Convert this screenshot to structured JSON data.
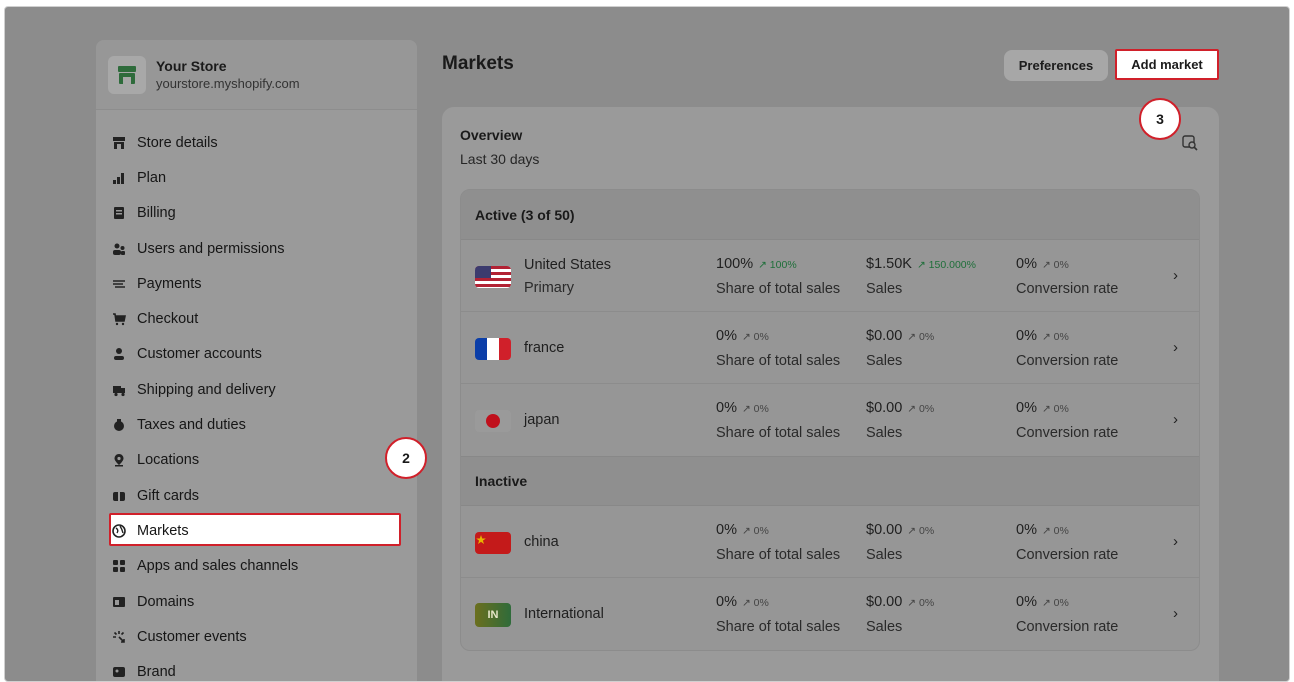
{
  "store": {
    "name": "Your Store",
    "domain": "yourstore.myshopify.com"
  },
  "sidebar": {
    "items": [
      {
        "label": "Store details",
        "icon": "store-icon"
      },
      {
        "label": "Plan",
        "icon": "plan-icon"
      },
      {
        "label": "Billing",
        "icon": "billing-icon"
      },
      {
        "label": "Users and permissions",
        "icon": "users-icon"
      },
      {
        "label": "Payments",
        "icon": "payments-icon"
      },
      {
        "label": "Checkout",
        "icon": "cart-icon"
      },
      {
        "label": "Customer accounts",
        "icon": "person-icon"
      },
      {
        "label": "Shipping and delivery",
        "icon": "truck-icon"
      },
      {
        "label": "Taxes and duties",
        "icon": "taxes-icon"
      },
      {
        "label": "Locations",
        "icon": "location-pin-icon"
      },
      {
        "label": "Gift cards",
        "icon": "gift-card-icon"
      },
      {
        "label": "Markets",
        "icon": "globe-icon"
      },
      {
        "label": "Apps and sales channels",
        "icon": "apps-icon"
      },
      {
        "label": "Domains",
        "icon": "domains-icon"
      },
      {
        "label": "Customer events",
        "icon": "events-icon"
      },
      {
        "label": "Brand",
        "icon": "brand-icon"
      }
    ]
  },
  "header": {
    "title": "Markets",
    "preferences_label": "Preferences",
    "add_market_label": "Add market"
  },
  "overview": {
    "title": "Overview",
    "period": "Last 30 days",
    "active_heading": "Active (3 of 50)",
    "inactive_heading": "Inactive",
    "metric_labels": {
      "share": "Share of total sales",
      "sales": "Sales",
      "conversion": "Conversion rate"
    },
    "markets": [
      {
        "name": "United States",
        "sub": "Primary",
        "flag": "us-flag-icon",
        "share": "100%",
        "share_trend": "↗ 100%",
        "sales": "$1.50K",
        "sales_trend": "↗ 150.000%",
        "conversion": "0%",
        "conversion_trend": "↗ 0%"
      },
      {
        "name": "france",
        "flag": "france-flag-icon",
        "share": "0%",
        "share_trend": "↗ 0%",
        "sales": "$0.00",
        "sales_trend": "↗ 0%",
        "conversion": "0%",
        "conversion_trend": "↗ 0%"
      },
      {
        "name": "japan",
        "flag": "japan-flag-icon",
        "share": "0%",
        "share_trend": "↗ 0%",
        "sales": "$0.00",
        "sales_trend": "↗ 0%",
        "conversion": "0%",
        "conversion_trend": "↗ 0%"
      },
      {
        "name": "china",
        "flag": "china-flag-icon",
        "share": "0%",
        "share_trend": "↗ 0%",
        "sales": "$0.00",
        "sales_trend": "↗ 0%",
        "conversion": "0%",
        "conversion_trend": "↗ 0%"
      },
      {
        "name": "International",
        "flag": "international-badge-icon",
        "flag_text": "IN",
        "share": "0%",
        "share_trend": "↗ 0%",
        "sales": "$0.00",
        "sales_trend": "↗ 0%",
        "conversion": "0%",
        "conversion_trend": "↗ 0%"
      }
    ]
  },
  "annotations": {
    "step2": "2",
    "step3": "3"
  },
  "colors": {
    "highlight": "#d0202a",
    "trend_positive": "#1f6f3a",
    "overlay": "#8c8c8c"
  }
}
